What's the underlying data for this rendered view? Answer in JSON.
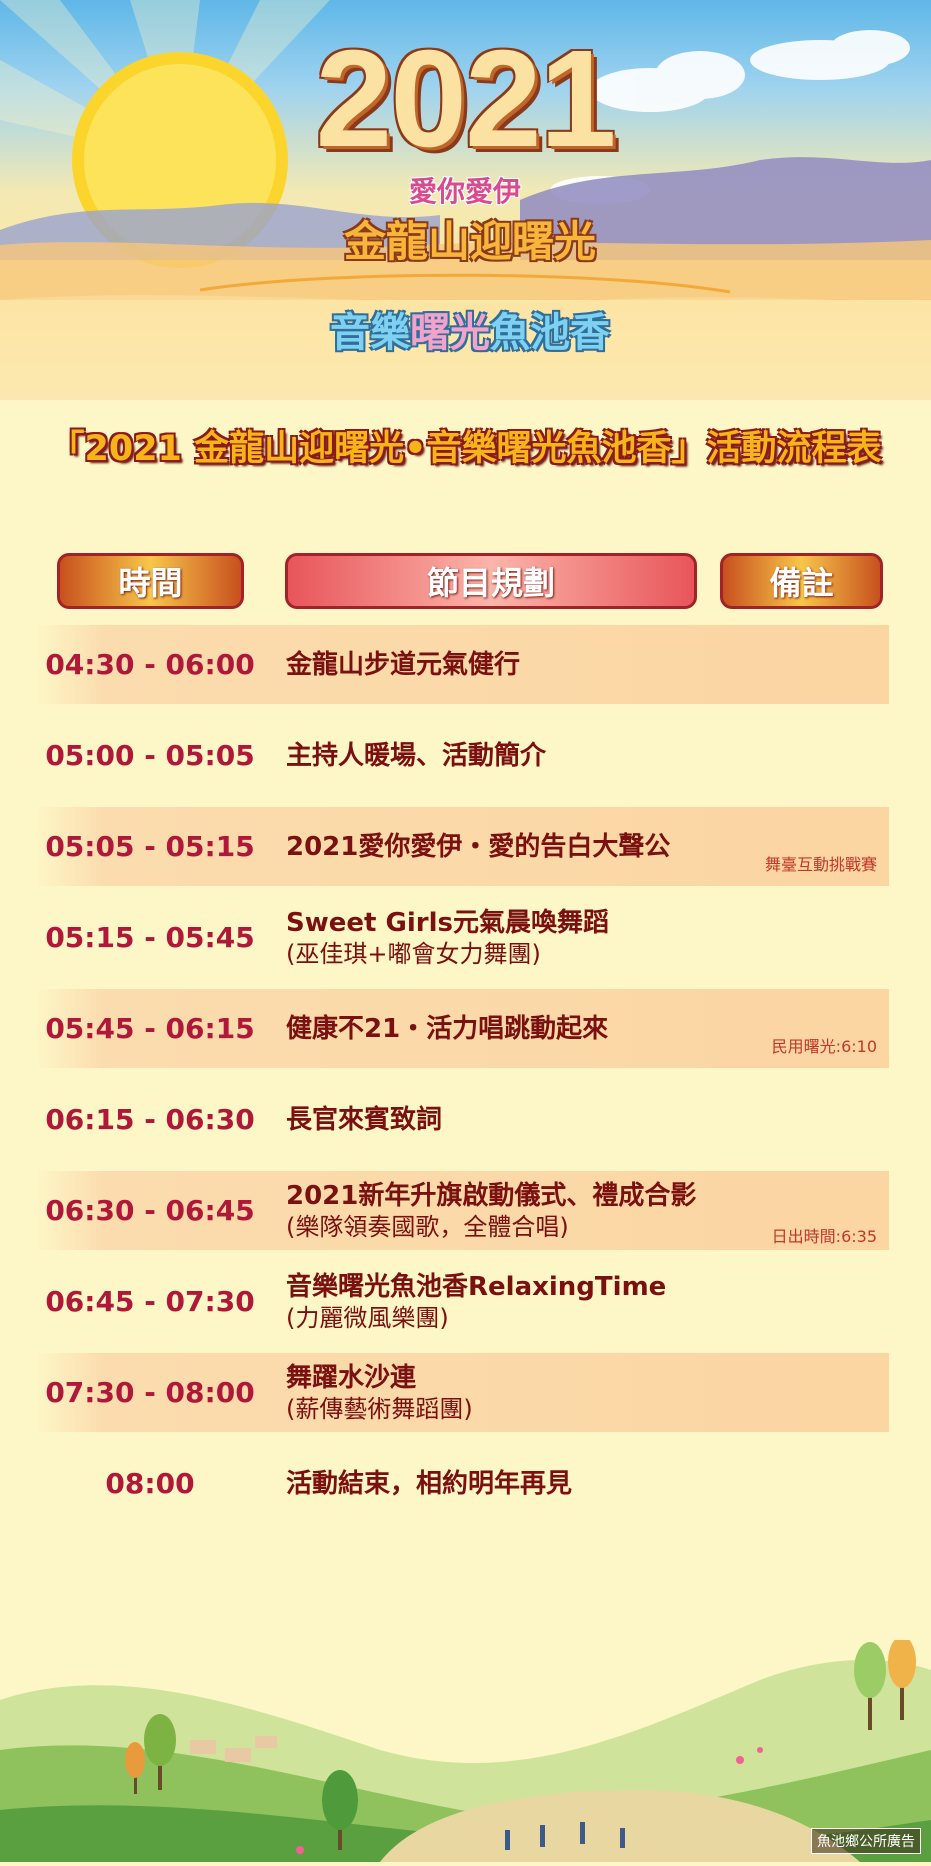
{
  "logo": {
    "year": "2021",
    "tagline": "愛你愛伊",
    "title": "金龍山迎曙光",
    "subtitle_a": "音樂",
    "subtitle_b": "曙光",
    "subtitle_c": "魚池香"
  },
  "main_title": "「2021 金龍山迎曙光•音樂曙光魚池香」活動流程表",
  "headers": {
    "time": "時間",
    "program": "節目規劃",
    "note": "備註"
  },
  "schedule": [
    {
      "time": "04:30 - 06:00",
      "program": "金龍山步道元氣健行",
      "sub": "",
      "note": ""
    },
    {
      "time": "05:00 - 05:05",
      "program": "主持人暖場、活動簡介",
      "sub": "",
      "note": ""
    },
    {
      "time": "05:05 - 05:15",
      "program": "2021愛你愛伊・愛的告白大聲公",
      "sub": "",
      "note": "舞臺互動挑戰賽"
    },
    {
      "time": "05:15 - 05:45",
      "program": "Sweet Girls元氣晨喚舞蹈",
      "sub": "(巫佳琪+嘟會女力舞團)",
      "note": ""
    },
    {
      "time": "05:45 - 06:15",
      "program": "健康不21・活力唱跳動起來",
      "sub": "",
      "note": "民用曙光:6:10"
    },
    {
      "time": "06:15 - 06:30",
      "program": "長官來賓致詞",
      "sub": "",
      "note": ""
    },
    {
      "time": "06:30 - 06:45",
      "program": "2021新年升旗啟動儀式、禮成合影",
      "sub": "(樂隊領奏國歌，全體合唱)",
      "note": "日出時間:6:35"
    },
    {
      "time": "06:45 - 07:30",
      "program": "音樂曙光魚池香RelaxingTime",
      "sub": "(力麗微風樂團)",
      "note": ""
    },
    {
      "time": "07:30 - 08:00",
      "program": "舞躍水沙連",
      "sub": "(薪傳藝術舞蹈團)",
      "note": ""
    },
    {
      "time": "08:00",
      "program": "活動結束，相約明年再見",
      "sub": "",
      "note": ""
    }
  ],
  "credit": "魚池鄉公所廣告",
  "colors": {
    "background": "#fdf6c6",
    "time_text": "#b0183a",
    "program_text": "#7a1010",
    "title_fill": "#f4b41a",
    "title_outline": "#8b1a1a"
  }
}
